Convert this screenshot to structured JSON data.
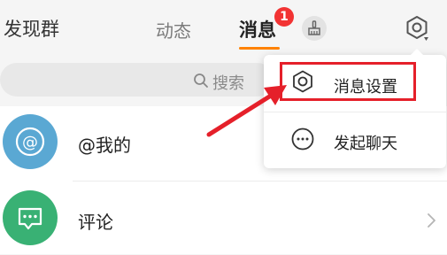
{
  "header": {
    "left_title": "发现群",
    "tab_dongtai": "动态",
    "tab_xiaoxi": "消息",
    "badge_count": "1",
    "icons": [
      "broom-icon",
      "gear-icon"
    ],
    "accent_color": "#ff8200",
    "badge_color": "#f23333"
  },
  "search": {
    "placeholder": "搜索"
  },
  "list": {
    "items": [
      {
        "label": "@我的",
        "icon": "at-icon",
        "color": "#5aa8d3"
      },
      {
        "label": "评论",
        "icon": "comment-icon",
        "color": "#39b174"
      }
    ]
  },
  "dropdown": {
    "items": [
      {
        "label": "消息设置",
        "icon": "gear-icon"
      },
      {
        "label": "发起聊天",
        "icon": "chat-bubble-icon"
      }
    ]
  },
  "annotation": {
    "highlight_color": "#e5202a"
  }
}
